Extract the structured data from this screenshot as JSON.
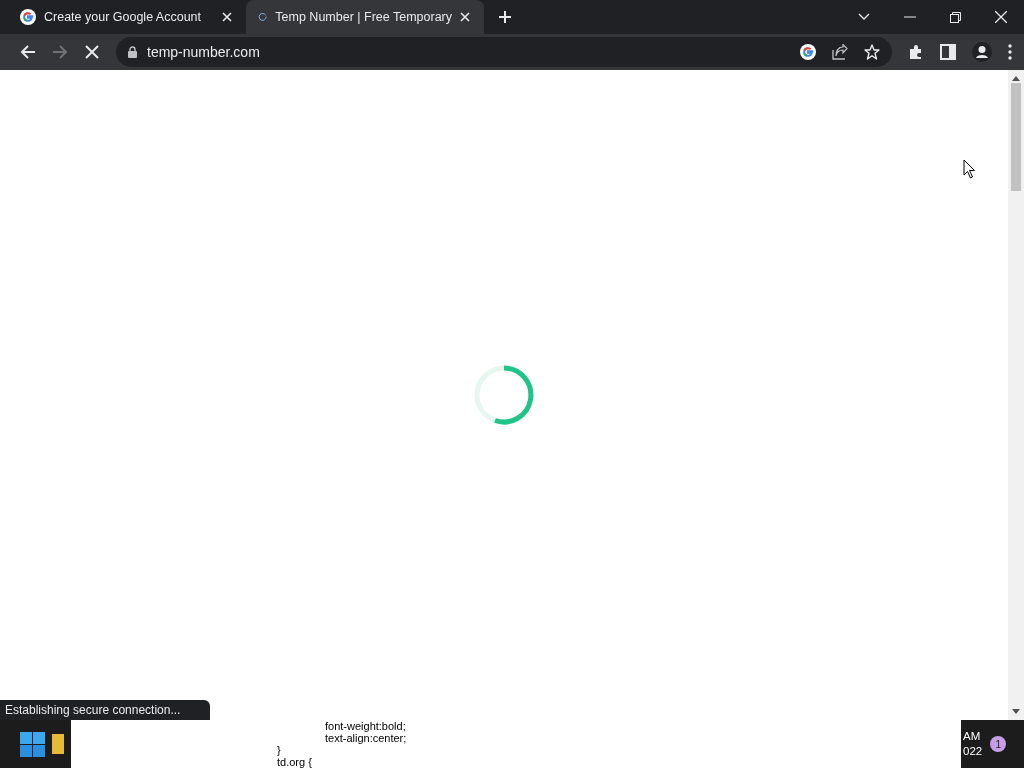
{
  "tabs": [
    {
      "title": "Create your Google Account",
      "selected": false,
      "loading": false
    },
    {
      "title": "Temp Number | Free Temporary",
      "selected": true,
      "loading": true
    }
  ],
  "address_bar": {
    "url": "temp-number.com",
    "loading": true
  },
  "page": {
    "loading": true
  },
  "status_bubble": "Establishing secure connection...",
  "taskbar": {
    "popup_lines": [
      {
        "text": "font-weight:bold;",
        "indent": true
      },
      {
        "text": "text-align:center;",
        "indent": true
      },
      {
        "text": "}",
        "indent": false
      },
      {
        "text": "td.org {",
        "indent": false
      }
    ],
    "clock": [
      "AM",
      "022"
    ],
    "notification_count": "1"
  }
}
